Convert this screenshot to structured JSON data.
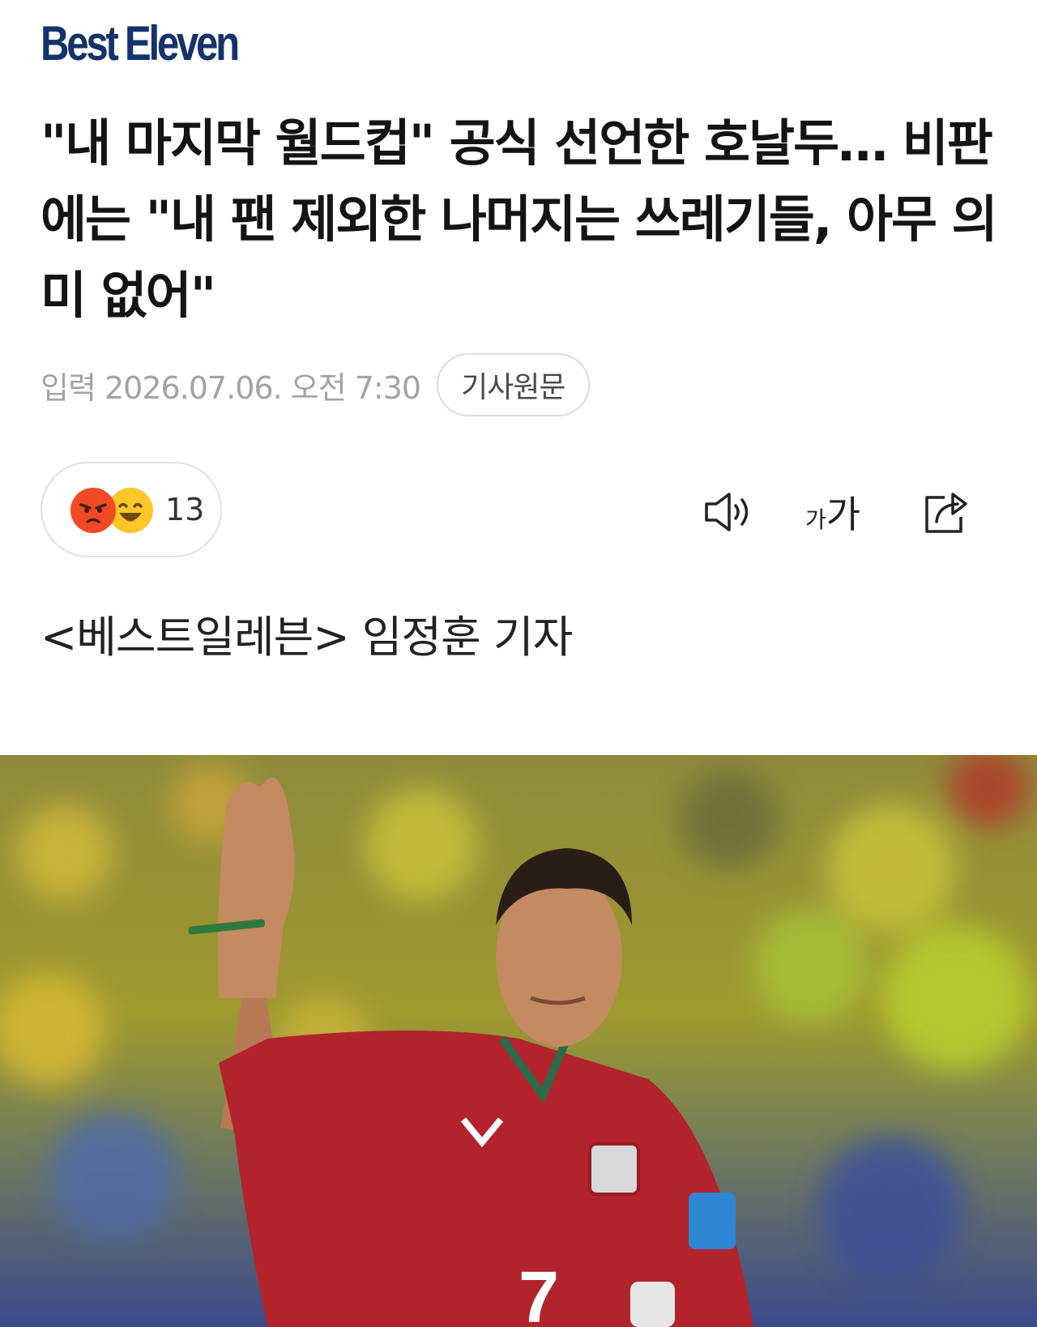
{
  "brand": {
    "logo_text": "Best Eleven",
    "logo_color": "#14326b"
  },
  "article": {
    "headline": "\"내 마지막 월드컵\" 공식 선언한 호날두… 비판에는 \"내 팬 제외한 나머지는 쓰레기들, 아무 의미 없어\"",
    "published": "입력 2026.07.06. 오전 7:30",
    "source_button": "기사원문",
    "byline": "<베스트일레븐> 임정훈 기자"
  },
  "reactions": {
    "count": "13",
    "emojis": [
      "angry-emoji",
      "laughing-emoji"
    ]
  },
  "toolbar": {
    "speaker_icon": "speaker-icon",
    "font_size_icon": "font-size-icon",
    "font_size_small": "가",
    "font_size_large": "가",
    "share_icon": "share-icon"
  },
  "hero_image": {
    "description_icon": "player-photo",
    "jersey_number": "7"
  }
}
